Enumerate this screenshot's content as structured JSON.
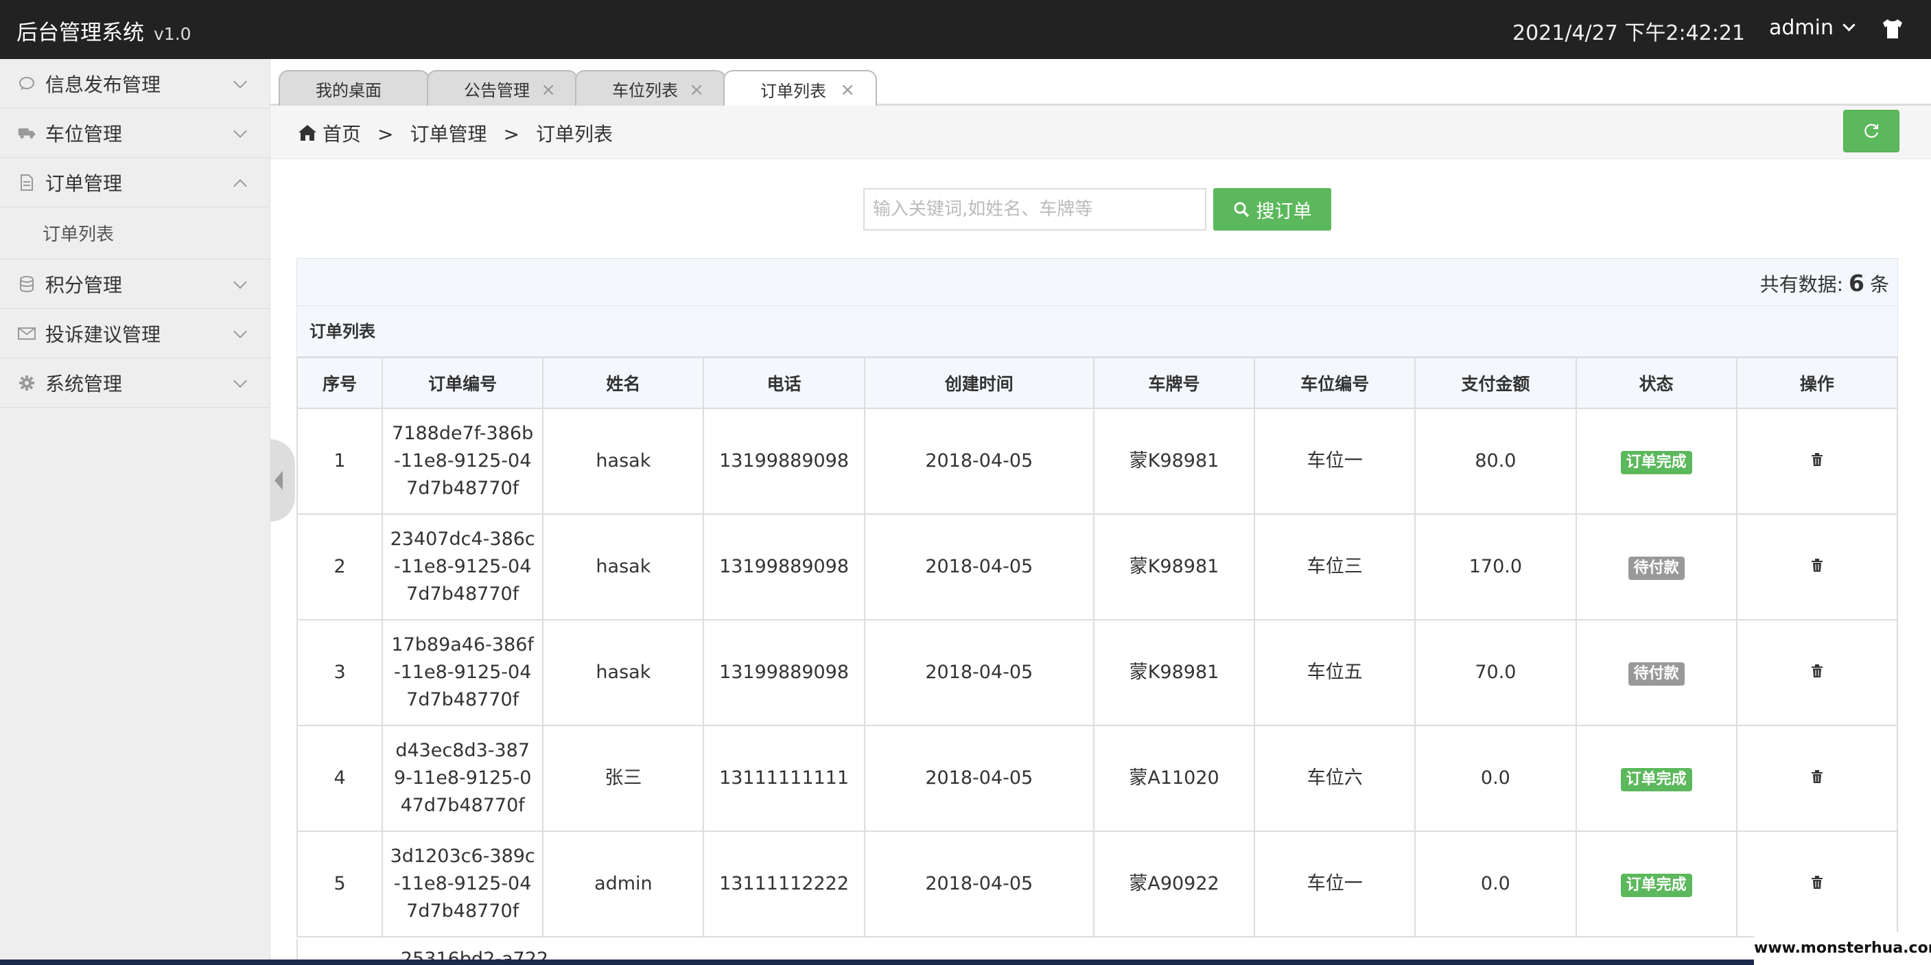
{
  "header": {
    "title": "后台管理系统",
    "version": "v1.0",
    "datetime": "2021/4/27 下午2:42:21",
    "user": "admin"
  },
  "sidebar": {
    "items": [
      {
        "label": "信息发布管理",
        "icon": "chat-icon"
      },
      {
        "label": "车位管理",
        "icon": "truck-icon"
      },
      {
        "label": "订单管理",
        "icon": "document-icon",
        "expanded": true
      },
      {
        "label": "积分管理",
        "icon": "database-icon"
      },
      {
        "label": "投诉建议管理",
        "icon": "envelope-icon"
      },
      {
        "label": "系统管理",
        "icon": "gear-icon"
      }
    ],
    "submenu": {
      "label": "订单列表"
    }
  },
  "tabs": [
    {
      "label": "我的桌面"
    },
    {
      "label": "公告管理"
    },
    {
      "label": "车位列表"
    },
    {
      "label": "订单列表",
      "active": true
    }
  ],
  "breadcrumb": {
    "home": "首页",
    "level1": "订单管理",
    "level2": "订单列表",
    "sep": ">"
  },
  "search": {
    "placeholder": "输入关键词,如姓名、车牌等",
    "button": "搜订单"
  },
  "summary": {
    "prefix": "共有数据:",
    "count": "6",
    "suffix": "条"
  },
  "panel": {
    "title": "订单列表"
  },
  "table": {
    "headers": [
      "序号",
      "订单编号",
      "姓名",
      "电话",
      "创建时间",
      "车牌号",
      "车位编号",
      "支付金额",
      "状态",
      "操作"
    ],
    "rows": [
      {
        "no": "1",
        "orderno": "7188de7f-386b-11e8-9125-047d7b48770f",
        "name": "hasak",
        "phone": "13199889098",
        "created": "2018-04-05",
        "plate": "蒙K98981",
        "slot": "车位一",
        "amount": "80.0",
        "status": "订单完成",
        "status_type": "done"
      },
      {
        "no": "2",
        "orderno": "23407dc4-386c-11e8-9125-047d7b48770f",
        "name": "hasak",
        "phone": "13199889098",
        "created": "2018-04-05",
        "plate": "蒙K98981",
        "slot": "车位三",
        "amount": "170.0",
        "status": "待付款",
        "status_type": "pending"
      },
      {
        "no": "3",
        "orderno": "17b89a46-386f-11e8-9125-047d7b48770f",
        "name": "hasak",
        "phone": "13199889098",
        "created": "2018-04-05",
        "plate": "蒙K98981",
        "slot": "车位五",
        "amount": "70.0",
        "status": "待付款",
        "status_type": "pending"
      },
      {
        "no": "4",
        "orderno": "d43ec8d3-3879-11e8-9125-047d7b48770f",
        "name": "张三",
        "phone": "13111111111",
        "created": "2018-04-05",
        "plate": "蒙A11020",
        "slot": "车位六",
        "amount": "0.0",
        "status": "订单完成",
        "status_type": "done"
      },
      {
        "no": "5",
        "orderno": "3d1203c6-389c-11e8-9125-047d7b48770f",
        "name": "admin",
        "phone": "13111112222",
        "created": "2018-04-05",
        "plate": "蒙A90922",
        "slot": "车位一",
        "amount": "0.0",
        "status": "订单完成",
        "status_type": "done"
      }
    ],
    "partial_row_orderno": "25316bd2-a722"
  },
  "watermark": "www.monsterhua.com",
  "colors": {
    "header_bg": "#222222",
    "primary_green": "#5cb85c",
    "pending_gray": "#999999",
    "sidebar_bg": "#eeeeee"
  }
}
